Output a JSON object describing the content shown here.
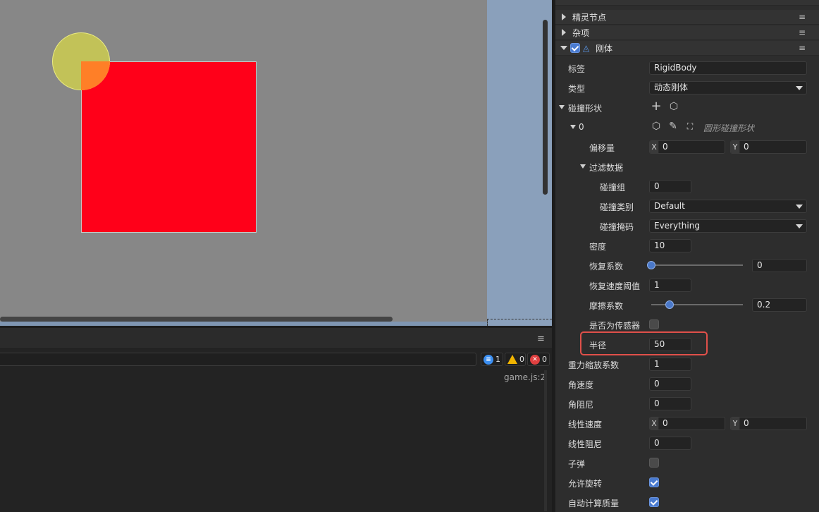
{
  "inspector": {
    "sections": {
      "sprite_node": "精灵节点",
      "misc": "杂项",
      "rigidbody": "刚体"
    },
    "props": {
      "tag_label": "标签",
      "tag_value": "RigidBody",
      "type_label": "类型",
      "type_value": "动态刚体",
      "collider_shapes_label": "碰撞形状",
      "shape_index": "0",
      "shape_type_hint": "圆形碰撞形状",
      "offset_label": "偏移量",
      "offset_x_tag": "X",
      "offset_x": "0",
      "offset_y_tag": "Y",
      "offset_y": "0",
      "filter_label": "过滤数据",
      "group_label": "碰撞组",
      "group_value": "0",
      "category_label": "碰撞类别",
      "category_value": "Default",
      "mask_label": "碰撞掩码",
      "mask_value": "Everything",
      "density_label": "密度",
      "density_value": "10",
      "restitution_label": "恢复系数",
      "restitution_value": "0",
      "restitution_fraction": 0,
      "restitution_threshold_label": "恢复速度阈值",
      "restitution_threshold_value": "1",
      "friction_label": "摩擦系数",
      "friction_value": "0.2",
      "friction_fraction": 0.2,
      "sensor_label": "是否为传感器",
      "radius_label": "半径",
      "radius_value": "50",
      "gravity_scale_label": "重力缩放系数",
      "gravity_scale_value": "1",
      "angular_velocity_label": "角速度",
      "angular_velocity_value": "0",
      "angular_damping_label": "角阻尼",
      "angular_damping_value": "0",
      "linear_velocity_label": "线性速度",
      "linear_velocity_x_tag": "X",
      "linear_velocity_x": "0",
      "linear_velocity_y_tag": "Y",
      "linear_velocity_y": "0",
      "linear_damping_label": "线性阻尼",
      "linear_damping_value": "0",
      "bullet_label": "子弹",
      "allow_rotation_label": "允许旋转",
      "auto_mass_label": "自动计算质量"
    },
    "checks": {
      "rigidbody_enabled": true,
      "sensor": false,
      "bullet": false,
      "allow_rotation": true,
      "auto_mass": true
    }
  },
  "console": {
    "info_count": "1",
    "warn_count": "0",
    "error_count": "0",
    "log_source": "game.js:2",
    "menu_icon": "≡"
  },
  "colors": {
    "scene_bg": "#878787",
    "red_box": "#ff0019",
    "circle": "#cdcd50",
    "accent": "#4a7bd0",
    "highlight": "#e0504a"
  }
}
